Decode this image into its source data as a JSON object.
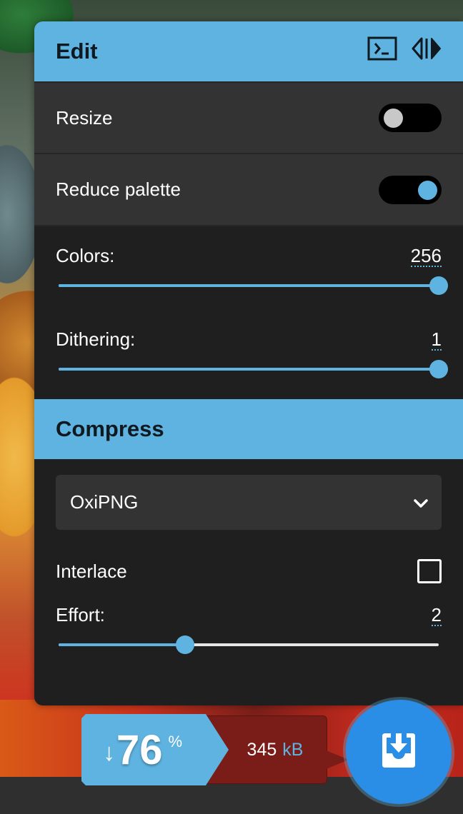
{
  "edit": {
    "title": "Edit",
    "icons": [
      "terminal-icon",
      "swap-sides-icon"
    ],
    "resize": {
      "label": "Resize",
      "enabled": false
    },
    "reduce_palette": {
      "label": "Reduce palette",
      "enabled": true
    },
    "colors": {
      "label": "Colors:",
      "value": "256",
      "min": 2,
      "max": 256
    },
    "dithering": {
      "label": "Dithering:",
      "value": "1",
      "min": 0,
      "max": 1
    }
  },
  "compress": {
    "title": "Compress",
    "encoder": {
      "selected": "OxiPNG"
    },
    "interlace": {
      "label": "Interlace",
      "checked": false
    },
    "effort": {
      "label": "Effort:",
      "value": "2",
      "min": 0,
      "max": 6
    }
  },
  "results": {
    "arrow": "↓",
    "percent": "76",
    "percent_sign": "%",
    "size_value": "345",
    "size_unit": "kB"
  },
  "download": {
    "icon": "download-icon"
  },
  "colors": {
    "accent": "#5fb3e0",
    "panel": "#1f1f1f",
    "row": "#333333",
    "download": "#2a8ee6",
    "size_bg": "#7a1c18"
  }
}
